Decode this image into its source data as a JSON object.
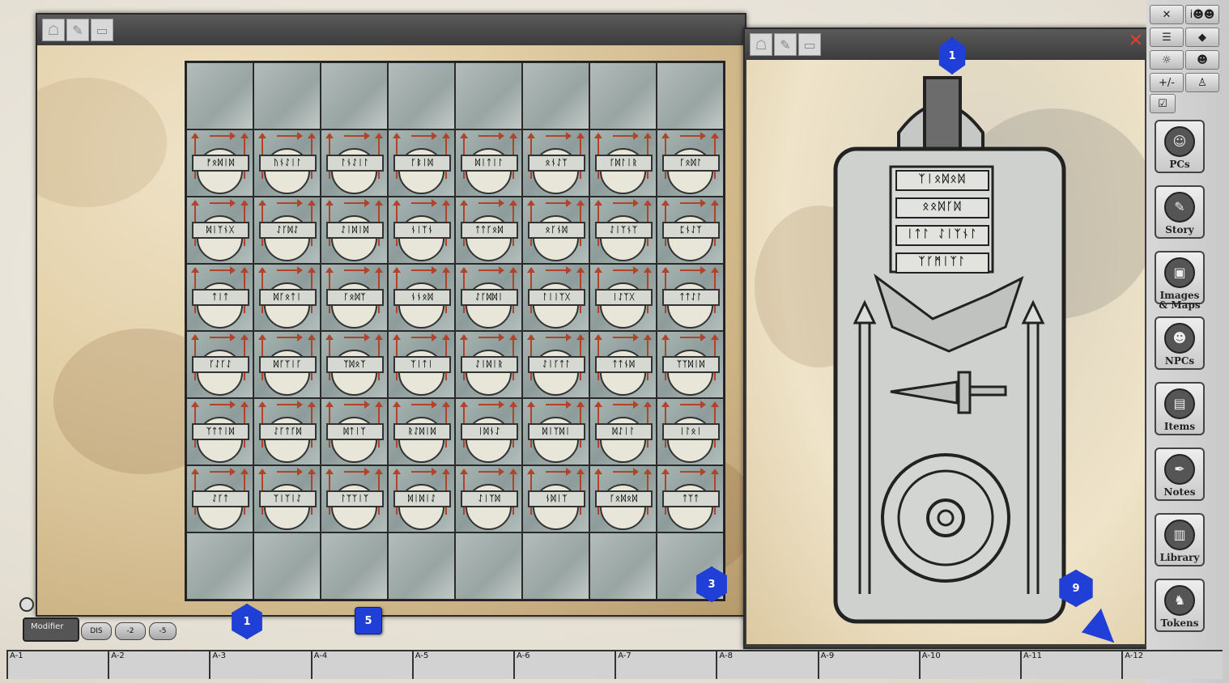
{
  "left_window": {
    "tools": [
      "mask-icon",
      "pencil-icon",
      "eraser-icon"
    ],
    "grid": {
      "rows": [
        [
          "",
          "",
          "",
          "",
          "",
          "",
          "",
          ""
        ],
        [
          "ᚠᛟᛞᛁᛞ",
          "ᚢᚾᛇᛁᛚ",
          "ᛚᚾᛇᛁᛚ",
          "ᚴᛒᛁᛞ",
          "ᛞᛁᛏᛁᛚ",
          "ᛟᚾᛇᛉ",
          "ᚴᛞᛚᛁᚱ",
          "ᚴᛟᛞᛚ"
        ],
        [
          "ᛞᛁᛉᚾᚷ",
          "ᛇᚴᛞᛇ",
          "ᛇᛁᛞᛁᛞ",
          "ᚾᛁᛉᚾ",
          "ᛏᛏᚴᛟᛞ",
          "ᛟᚴᚾᛞ",
          "ᛇᛁᛉᚾᛉ",
          "ᛈᚾᛇᛉ"
        ],
        [
          "ᛏᛁᛏ",
          "ᛞᚴᛟᛏᛁ",
          "ᚴᛟᛞᛉ",
          "ᚾᚾᛟᛞ",
          "ᛇᚴᛞᛞᛁ",
          "ᛚᛁᛁᛉᚷ",
          "ᛁᛇᛉᚷ",
          "ᛏᛏᛇᛚ"
        ],
        [
          "ᚴᛇᚴᛇ",
          "ᛞᚴᛉᛁᚴ",
          "ᛉᛞᛟᛉ",
          "ᛉᛁᛏᛁ",
          "ᛇᛁᛞᛁᚱ",
          "ᛇᛁᚴᛏᛚ",
          "ᛏᛏᚾᛞ",
          "ᛉᛉᛞᛁᛞ"
        ],
        [
          "ᛉᛏᛏᛁᛞ",
          "ᛇᚴᛏᚴᛞ",
          "ᛞᛏᛁᛉ",
          "ᚱᛇᛞᛁᛞ",
          "ᛁᛞᚾᛇ",
          "ᛞᛁᛉᛞᛁ",
          "ᛞᛇᛁᛚ",
          "ᛁᛚᛟᛁ"
        ],
        [
          "ᛇᚴᛏ",
          "ᛉᛁᛉᛁᛇ",
          "ᛚᛉᛉᛁᛉ",
          "ᛞᛁᛞᛁᛇ",
          "ᛇᛁᛉᛞ",
          "ᚾᛞᛁᛉ",
          "ᚴᛟᛞᛟᛞ",
          "ᛏᛉᛏ"
        ],
        [
          "",
          "",
          "",
          "",
          "",
          "",
          "",
          ""
        ]
      ]
    }
  },
  "right_window": {
    "tools": [
      "mask-icon",
      "pencil-icon",
      "eraser-icon"
    ],
    "close": "✕",
    "stele_lines": [
      "ᛉᛁᛟᛞᛟᛞ",
      "ᛟᛟᛞᚴᛞ",
      "ᛁᛏᛚ ᛇᛁᛉᚾᛚ",
      "ᛉᚴᛗᛁᛉᛚ"
    ]
  },
  "dice": {
    "left_d10": "1",
    "left_d6": "5",
    "grid_d10": "3",
    "right_top_d4": "1",
    "right_bottom_d10": "9"
  },
  "modifier": {
    "label": "Modifier",
    "buttons": [
      "DIS",
      "-2",
      "-5"
    ]
  },
  "sidebar": {
    "small_buttons": [
      [
        "dice-icon",
        "party-icon"
      ],
      [
        "list-icon",
        "token-icon"
      ],
      [
        "lighting-icon",
        "mask-icon"
      ],
      [
        "+/-",
        "walk-icon"
      ],
      [
        "check-icon",
        ""
      ]
    ],
    "small_text": {
      "plusminus": "+/-",
      "info": "i"
    },
    "buttons": [
      {
        "label": "PCs",
        "icon": "pcs-icon",
        "glyph": "☺"
      },
      {
        "label": "Story",
        "icon": "story-icon",
        "glyph": "✎"
      },
      {
        "label": "Images & Maps",
        "icon": "images-icon",
        "glyph": "▣"
      },
      {
        "label": "NPCs",
        "icon": "npcs-icon",
        "glyph": "☻"
      },
      {
        "label": "Items",
        "icon": "items-icon",
        "glyph": "▤"
      },
      {
        "label": "Notes",
        "icon": "notes-icon",
        "glyph": "✒"
      },
      {
        "label": "Library",
        "icon": "library-icon",
        "glyph": "▥"
      },
      {
        "label": "Tokens",
        "icon": "tokens-icon",
        "glyph": "♞"
      }
    ]
  },
  "hotkeys": [
    "A-1",
    "A-2",
    "A-3",
    "A-4",
    "A-5",
    "A-6",
    "A-7",
    "A-8",
    "A-9",
    "A-10",
    "A-11",
    "A-12"
  ]
}
